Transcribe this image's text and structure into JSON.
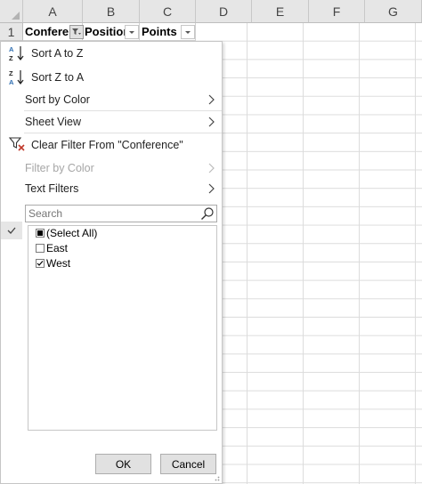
{
  "columns": [
    "A",
    "B",
    "C",
    "D",
    "E",
    "F",
    "G"
  ],
  "row_number": "1",
  "header_cells": [
    "Conferen",
    "Position",
    "Points"
  ],
  "menu": {
    "sort_a_to_z": "Sort A to Z",
    "sort_z_to_a": "Sort Z to A",
    "sort_by_color": "Sort by Color",
    "sheet_view": "Sheet View",
    "clear_filter": "Clear Filter From \"Conference\"",
    "filter_by_color": "Filter by Color",
    "text_filters": "Text Filters"
  },
  "search": {
    "placeholder": "Search"
  },
  "list": [
    {
      "label": "(Select All)",
      "state": "partial"
    },
    {
      "label": "East",
      "state": "unchecked"
    },
    {
      "label": "West",
      "state": "checked"
    }
  ],
  "buttons": {
    "ok": "OK",
    "cancel": "Cancel"
  },
  "icons": {
    "sort_az": "sort-ascending-icon",
    "sort_za": "sort-descending-icon",
    "clear_filter": "clear-filter-icon",
    "search": "search-icon",
    "submenu": "chevron-right-icon",
    "filter_button": "filter-dropdown-icon",
    "dropdown": "dropdown-arrow-icon"
  }
}
